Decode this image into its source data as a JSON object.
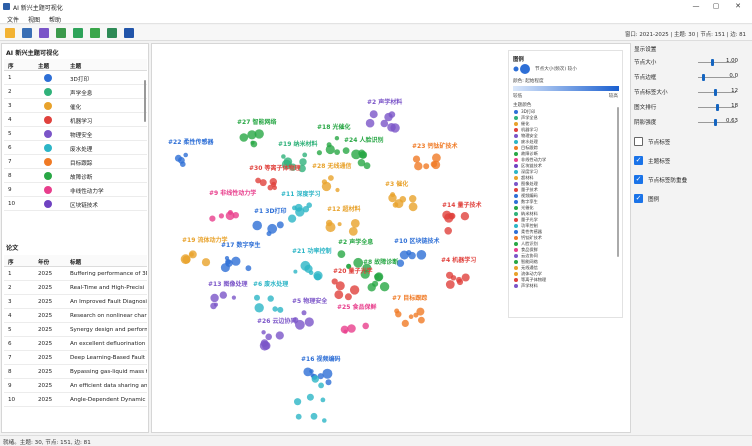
{
  "window": {
    "title": "AI 新兴主题可视化",
    "controls": [
      "—",
      "▢",
      "✕"
    ]
  },
  "menu": [
    "文件",
    "视图",
    "帮助"
  ],
  "toolbar": {
    "buttons": [
      {
        "name": "open-folder-icon",
        "color": "#f2b233"
      },
      {
        "name": "save-icon",
        "color": "#3a6fb5"
      },
      {
        "name": "palette-icon",
        "color": "#7a55c8"
      },
      {
        "name": "layout-icon",
        "color": "#3c9a4c"
      },
      {
        "name": "frame-icon",
        "color": "#2ea35a"
      },
      {
        "name": "comment-icon",
        "color": "#3aa64a"
      },
      {
        "name": "refresh-icon",
        "color": "#2e8b57"
      },
      {
        "name": "run-icon",
        "color": "#2255aa"
      }
    ],
    "status": "窗口: 2021-2025 | 主题: 30 | 节点: 151 | 边: 81"
  },
  "left": {
    "topics_title": "AI 新兴主题可视化",
    "topics_headers": [
      "序",
      "主题",
      "主题"
    ],
    "topics": [
      {
        "id": "1",
        "color": "#2e6fd6",
        "label": "3D打印"
      },
      {
        "id": "2",
        "color": "#30b27a",
        "label": "声学全息"
      },
      {
        "id": "3",
        "color": "#e8a22b",
        "label": "催化"
      },
      {
        "id": "4",
        "color": "#e0413c",
        "label": "机器学习"
      },
      {
        "id": "5",
        "color": "#7b55c8",
        "label": "物理安全"
      },
      {
        "id": "6",
        "color": "#2cb5c6",
        "label": "废水处理"
      },
      {
        "id": "7",
        "color": "#f07a25",
        "label": "目标跟踪"
      },
      {
        "id": "8",
        "color": "#28a745",
        "label": "故障诊断"
      },
      {
        "id": "9",
        "color": "#e83e8c",
        "label": "非线性动力学"
      },
      {
        "id": "10",
        "color": "#6f42c1",
        "label": "区块链技术"
      }
    ],
    "papers_title": "论文",
    "papers_headers": [
      "序",
      "年份",
      "标题"
    ],
    "papers": [
      {
        "id": "1",
        "year": "2025",
        "title": "Buffering performance of 3D"
      },
      {
        "id": "2",
        "year": "2025",
        "title": "Real-Time and High-Precisi"
      },
      {
        "id": "3",
        "year": "2025",
        "title": "An Improved Fault Diagnosis"
      },
      {
        "id": "4",
        "year": "2025",
        "title": "Research on nonlinear chara"
      },
      {
        "id": "5",
        "year": "2025",
        "title": "Synergy design and perform"
      },
      {
        "id": "6",
        "year": "2025",
        "title": "An excellent defluorination r"
      },
      {
        "id": "7",
        "year": "2025",
        "title": "Deep Learning-Based Fault"
      },
      {
        "id": "8",
        "year": "2025",
        "title": "Bypassing gas-liquid mass t"
      },
      {
        "id": "9",
        "year": "2025",
        "title": "An efficient data sharing an"
      },
      {
        "id": "10",
        "year": "2025",
        "title": "Angle-Dependent Dynamic"
      }
    ]
  },
  "graph": {
    "clusters": [
      {
        "label": "#2 声学材料",
        "color": "#7b55c8"
      },
      {
        "label": "#27 智能网络",
        "color": "#28a745"
      },
      {
        "label": "#18 光催化",
        "color": "#28a745"
      },
      {
        "label": "#24 人脸识别",
        "color": "#28a745"
      },
      {
        "label": "#22 柔性传感器",
        "color": "#2e6fd6"
      },
      {
        "label": "#19 纳米材料",
        "color": "#30b27a"
      },
      {
        "label": "#23 钙钛矿技术",
        "color": "#f07a25"
      },
      {
        "label": "#28 无线通信",
        "color": "#e8a22b"
      },
      {
        "label": "#30 等离子体物理",
        "color": "#e0413c"
      },
      {
        "label": "#3 催化",
        "color": "#e8a22b"
      },
      {
        "label": "#9 非线性动力学",
        "color": "#e83e8c"
      },
      {
        "label": "#11 深度学习",
        "color": "#2cb5c6"
      },
      {
        "label": "#12 超材料",
        "color": "#e8a22b"
      },
      {
        "label": "#14 量子技术",
        "color": "#e0413c"
      },
      {
        "label": "#1 3D打印",
        "color": "#2e6fd6"
      },
      {
        "label": "#19 流体动力学",
        "color": "#e8a22b"
      },
      {
        "label": "#17 数字孪生",
        "color": "#2e6fd6"
      },
      {
        "label": "#21 功率控制",
        "color": "#2cb5c6"
      },
      {
        "label": "#2 声学全息",
        "color": "#28a745"
      },
      {
        "label": "#10 区块链技术",
        "color": "#2e6fd6"
      },
      {
        "label": "#8 故障诊断",
        "color": "#28a745"
      },
      {
        "label": "#4 机器学习",
        "color": "#e0413c"
      },
      {
        "label": "#20 量子光学",
        "color": "#e0413c"
      },
      {
        "label": "#13 图像处理",
        "color": "#7b55c8"
      },
      {
        "label": "#6 废水处理",
        "color": "#2cb5c6"
      },
      {
        "label": "#5 物理安全",
        "color": "#7b55c8"
      },
      {
        "label": "#25 食品保鲜",
        "color": "#e83e8c"
      },
      {
        "label": "#7 目标跟踪",
        "color": "#f07a25"
      },
      {
        "label": "#26 云边协同",
        "color": "#7b55c8"
      },
      {
        "label": "#16 视频编码",
        "color": "#2e6fd6"
      }
    ],
    "legend": {
      "title": "图例",
      "size_caption": "节点大小(频次) 较小",
      "color_caption": "颜色: 起始程度",
      "scale_low": "较低",
      "scale_high": "较高",
      "topic_caption": "主题颜色",
      "entries": [
        {
          "label": "3D打印",
          "color": "#2e6fd6"
        },
        {
          "label": "声学全息",
          "color": "#30b27a"
        },
        {
          "label": "催化",
          "color": "#e8a22b"
        },
        {
          "label": "机器学习",
          "color": "#e0413c"
        },
        {
          "label": "物理安全",
          "color": "#7b55c8"
        },
        {
          "label": "废水处理",
          "color": "#2cb5c6"
        },
        {
          "label": "目标跟踪",
          "color": "#f07a25"
        },
        {
          "label": "故障诊断",
          "color": "#28a745"
        },
        {
          "label": "非线性动力学",
          "color": "#e83e8c"
        },
        {
          "label": "区块链技术",
          "color": "#6f42c1"
        },
        {
          "label": "深度学习",
          "color": "#2cb5c6"
        },
        {
          "label": "超材料",
          "color": "#e8a22b"
        },
        {
          "label": "图像处理",
          "color": "#7b55c8"
        },
        {
          "label": "量子技术",
          "color": "#e0413c"
        },
        {
          "label": "视频编码",
          "color": "#2e6fd6"
        },
        {
          "label": "数字孪生",
          "color": "#2e6fd6"
        },
        {
          "label": "光催化",
          "color": "#28a745"
        },
        {
          "label": "纳米材料",
          "color": "#30b27a"
        },
        {
          "label": "量子光学",
          "color": "#e0413c"
        },
        {
          "label": "功率控制",
          "color": "#2cb5c6"
        },
        {
          "label": "柔性传感器",
          "color": "#2e6fd6"
        },
        {
          "label": "钙钛矿技术",
          "color": "#f07a25"
        },
        {
          "label": "人脸识别",
          "color": "#28a745"
        },
        {
          "label": "食品保鲜",
          "color": "#e83e8c"
        },
        {
          "label": "云边协同",
          "color": "#7b55c8"
        },
        {
          "label": "智能网络",
          "color": "#28a745"
        },
        {
          "label": "无线通信",
          "color": "#e8a22b"
        },
        {
          "label": "流体动力学",
          "color": "#e8a22b"
        },
        {
          "label": "等离子体物理",
          "color": "#e0413c"
        },
        {
          "label": "声学材料",
          "color": "#7b55c8"
        }
      ]
    }
  },
  "right": {
    "title": "显示设置",
    "sliders": [
      {
        "label": "节点大小",
        "value": "1.00",
        "fraction": 0.35
      },
      {
        "label": "节点边框",
        "value": "0.0",
        "fraction": 0.1
      },
      {
        "label": "节点标签大小",
        "value": "12",
        "fraction": 0.45
      },
      {
        "label": "图文排行",
        "value": "18",
        "fraction": 0.5
      },
      {
        "label": "阴影强度",
        "value": "0.63",
        "fraction": 0.45
      }
    ],
    "checks": [
      {
        "label": "节点标签",
        "checked": false
      },
      {
        "label": "主题标签",
        "checked": true
      },
      {
        "label": "节点标签防重叠",
        "checked": true
      },
      {
        "label": "图例",
        "checked": true
      }
    ]
  },
  "status": "就绪。主题: 30, 节点: 151, 边: 81"
}
